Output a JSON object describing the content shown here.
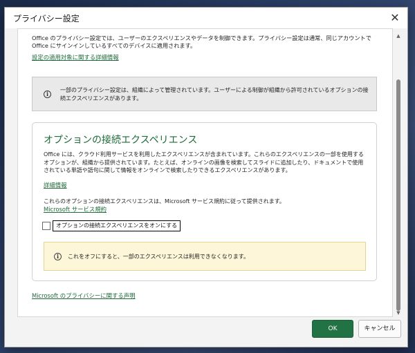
{
  "dialog": {
    "title": "プライバシー設定",
    "close_symbol": "✕"
  },
  "intro": {
    "text": "Office のプライバシー設定では、ユーザーのエクスペリエンスやデータを制御できます。プライバシー設定は通常、同じアカウントで Office にサインインしているすべてのデバイスに適用されます。",
    "link": "設定の適用対象に関する詳細情報"
  },
  "managed_notice": {
    "text": "一部のプライバシー設定は、組織によって管理されています。ユーザーによる制御が組織から許可されているオプションの接続エクスペリエンスがあります。"
  },
  "optional_experiences": {
    "title": "オプションの接続エクスペリエンス",
    "description": "Office には、クラウド利用サービスを利用したエクスペリエンスが含まれています。これらのエクスペリエンスの一部を使用するオプションが、組織から提供されています。たとえば、オンラインの画像を検索してスライドに追加したり、ドキュメントで使用されている単語や語句に関して情報をオンラインで検索したりできるエクスペリエンスがあります。",
    "details_link": "詳細情報",
    "terms_text": "これらのオプションの接続エクスペリエンスは、Microsoft サービス規約に従って提供されます。",
    "terms_link": "Microsoft サービス規約",
    "checkbox_label": "オプションの接続エクスペリエンスをオンにする",
    "checkbox_checked": false,
    "warning_text": "これをオフにすると、一部のエクスペリエンスは利用できなくなります。"
  },
  "privacy_statement_link": "Microsoft のプライバシーに関する声明",
  "buttons": {
    "ok": "OK",
    "cancel": "キャンセル"
  },
  "colors": {
    "accent": "#217346",
    "link": "#1e6b3a",
    "warning_bg": "#fdf6d8",
    "notice_bg": "#e9e9e9"
  },
  "icons": [
    "close-icon",
    "info-icon",
    "scroll-up-arrow",
    "scroll-down-arrow"
  ]
}
